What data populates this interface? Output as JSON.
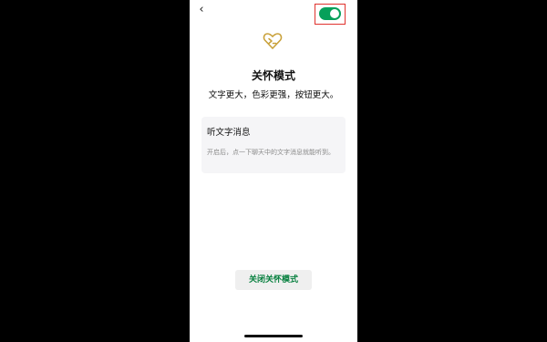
{
  "nav": {
    "back_icon": "chevron-left-icon"
  },
  "header": {
    "logo_icon": "care-mode-heart-icon",
    "title": "关怀模式",
    "subtitle": "文字更大，色彩更强，按钮更大。"
  },
  "settings": {
    "listen_text": {
      "label": "听文字消息",
      "enabled": true,
      "description": "开启后，点一下聊天中的文字消息就能听到。"
    }
  },
  "footer": {
    "close_button": "关闭关怀模式"
  },
  "colors": {
    "accent_green": "#07a05a",
    "button_text_green": "#07803f",
    "logo_gold": "#c9a13a",
    "highlight_red": "#e0332e"
  }
}
